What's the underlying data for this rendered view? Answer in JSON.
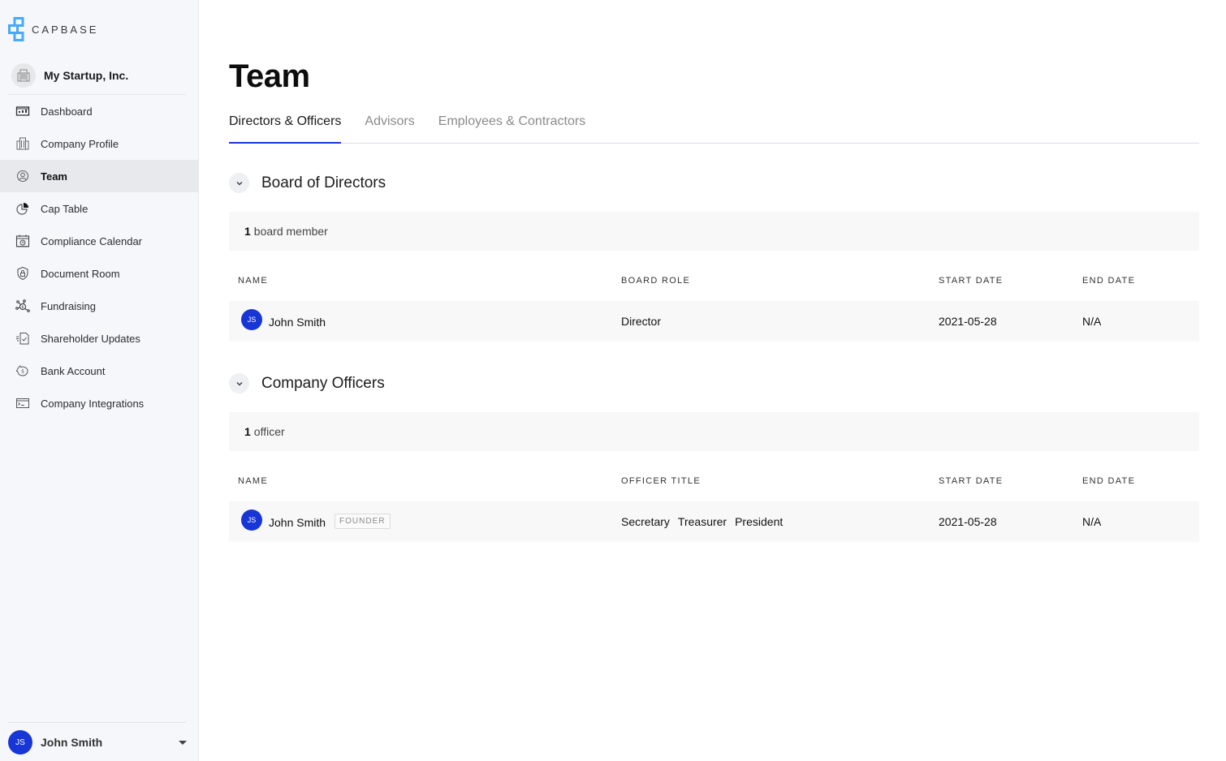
{
  "app": {
    "logo_text": "CAPBASE",
    "brand_color": "#1836d6",
    "logo_color": "#48a9f8"
  },
  "company": {
    "name": "My Startup, Inc."
  },
  "sidebar": {
    "items": [
      {
        "label": "Dashboard",
        "icon": "dashboard-icon",
        "active": false
      },
      {
        "label": "Company Profile",
        "icon": "building-icon",
        "active": false
      },
      {
        "label": "Team",
        "icon": "user-circle-icon",
        "active": true
      },
      {
        "label": "Cap Table",
        "icon": "pie-chart-icon",
        "active": false
      },
      {
        "label": "Compliance Calendar",
        "icon": "calendar-clock-icon",
        "active": false
      },
      {
        "label": "Document Room",
        "icon": "shield-lock-icon",
        "active": false
      },
      {
        "label": "Fundraising",
        "icon": "network-dollar-icon",
        "active": false
      },
      {
        "label": "Shareholder Updates",
        "icon": "document-check-icon",
        "active": false
      },
      {
        "label": "Bank Account",
        "icon": "piggy-bank-icon",
        "active": false
      },
      {
        "label": "Company Integrations",
        "icon": "terminal-window-icon",
        "active": false
      }
    ]
  },
  "user": {
    "initials": "JS",
    "name": "John Smith"
  },
  "page": {
    "title": "Team",
    "tabs": [
      {
        "label": "Directors & Officers",
        "active": true
      },
      {
        "label": "Advisors",
        "active": false
      },
      {
        "label": "Employees & Contractors",
        "active": false
      }
    ]
  },
  "board": {
    "title": "Board of Directors",
    "count": "1",
    "count_label": "board member",
    "columns": [
      "NAME",
      "BOARD ROLE",
      "START DATE",
      "END DATE"
    ],
    "rows": [
      {
        "initials": "JS",
        "name": "John Smith",
        "role": "Director",
        "start": "2021-05-28",
        "end": "N/A"
      }
    ]
  },
  "officers": {
    "title": "Company Officers",
    "count": "1",
    "count_label": "officer",
    "columns": [
      "NAME",
      "OFFICER TITLE",
      "START DATE",
      "END DATE"
    ],
    "rows": [
      {
        "initials": "JS",
        "name": "John Smith",
        "badge": "FOUNDER",
        "titles": [
          "Secretary",
          "Treasurer",
          "President"
        ],
        "start": "2021-05-28",
        "end": "N/A"
      }
    ]
  }
}
